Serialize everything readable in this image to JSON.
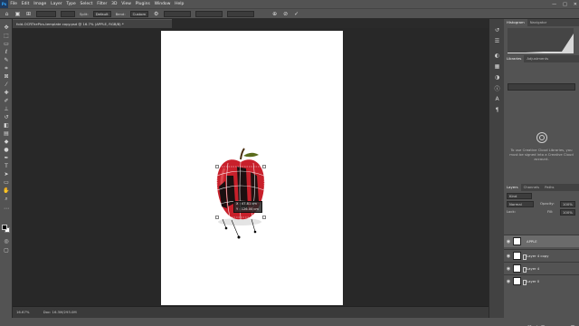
{
  "app": {
    "logo": "Ps"
  },
  "menu": [
    "File",
    "Edit",
    "Image",
    "Layer",
    "Type",
    "Select",
    "Filter",
    "3D",
    "View",
    "Plugins",
    "Window",
    "Help"
  ],
  "window_controls": [
    "—",
    "□",
    "✕"
  ],
  "options_bar": {
    "split_label": "Split:",
    "split_value": "Default",
    "bend_label": "Bend:",
    "bend_value": "Custom"
  },
  "document_tab": "fold-OCRThePics-template copy.psd @ 16.7% (APPLE, RGB/8) *",
  "status_bar": {
    "zoom": "16.67%",
    "doc": "Doc: 16.3M/293.0M"
  },
  "transform_tooltip": {
    "line1": "X : 47.81 cm",
    "line2": "Y : 126.00 cm"
  },
  "panels": {
    "top_tabs": [
      "Histogram",
      "Navigator"
    ],
    "lib_tabs": [
      "Libraries",
      "Adjustments"
    ],
    "libraries_select": "",
    "cc_message": "To use Creative Cloud Libraries, you must be signed into a Creative Cloud account.",
    "layer_tabs": [
      "Layers",
      "Channels",
      "Paths"
    ],
    "kind_label": "Kind",
    "blend_mode": "Normal",
    "opacity_label": "Opacity:",
    "opacity_value": "100%",
    "lock_label": "Lock:",
    "fill_label": "Fill:",
    "fill_value": "100%"
  },
  "layers": [
    {
      "name": "APPLE",
      "visible": true,
      "selected": true
    },
    {
      "name": "Layer 4 copy",
      "visible": true,
      "selected": false
    },
    {
      "name": "Layer 4",
      "visible": true,
      "selected": false
    },
    {
      "name": "Layer 0",
      "visible": true,
      "selected": false
    }
  ],
  "colors": {
    "chrome": "#535353",
    "workspace": "#282828",
    "canvas": "#ffffff",
    "apple_red": "#c8202b",
    "selected_layer": "#6b6b6b"
  }
}
